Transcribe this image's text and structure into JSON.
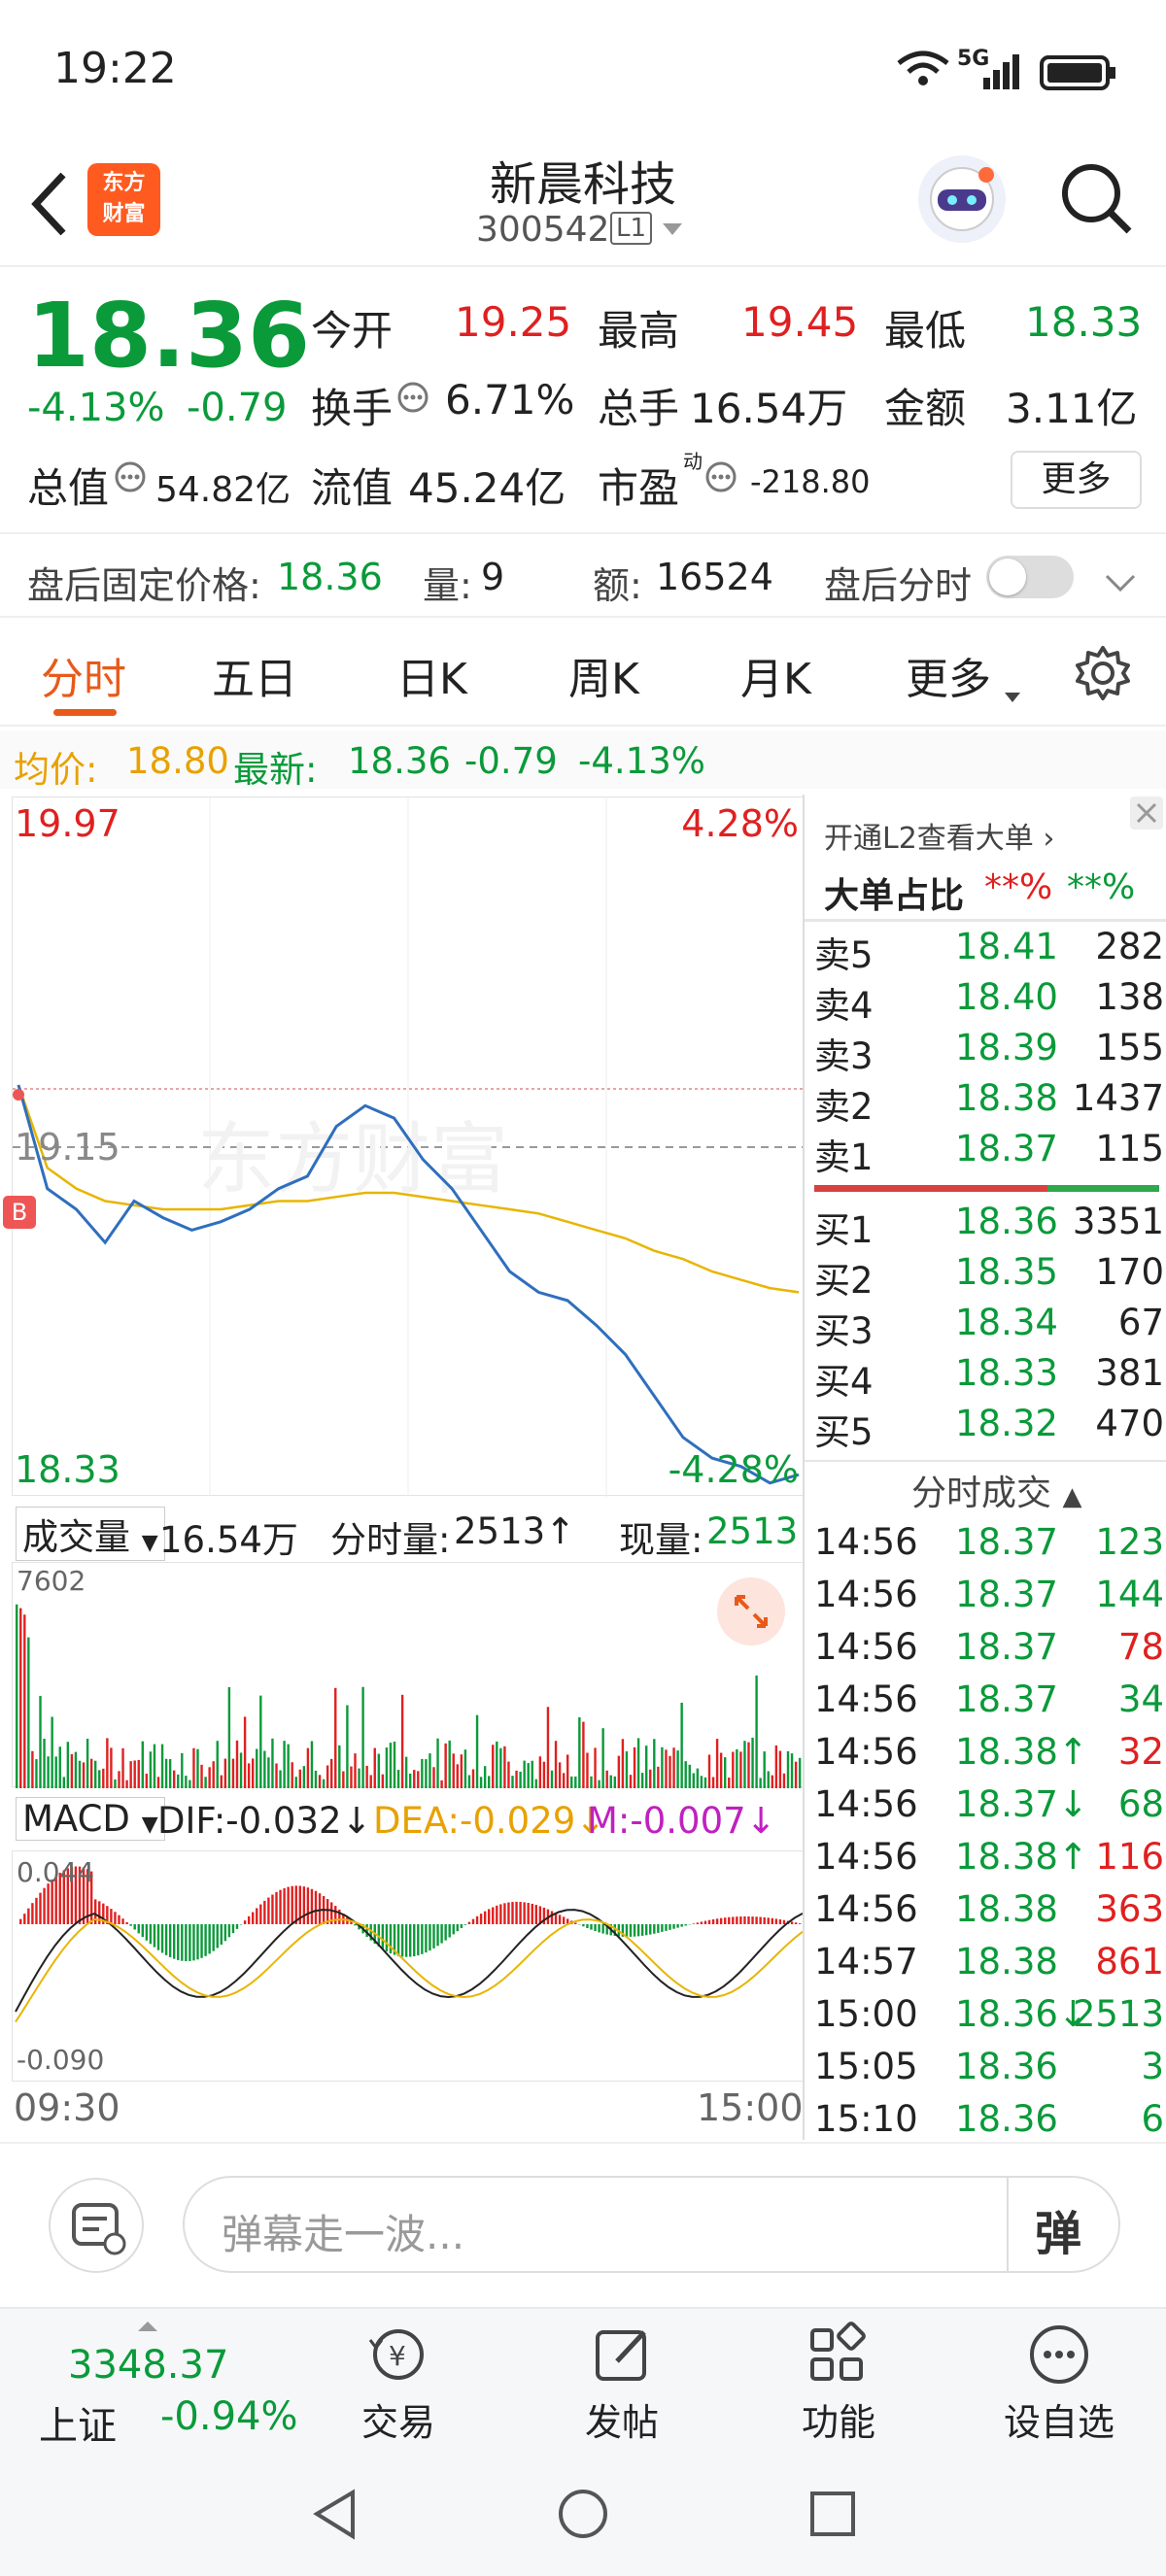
{
  "status_bar": {
    "time": "19:22",
    "network": "5G"
  },
  "header": {
    "title": "新晨科技",
    "code": "300542",
    "level_badge": "L1",
    "logo_line1": "东方",
    "logo_line2": "财富"
  },
  "quote": {
    "price": "18.36",
    "change_pct": "-4.13%",
    "change": "-0.79",
    "open_label": "今开",
    "open": "19.25",
    "high_label": "最高",
    "high": "19.45",
    "low_label": "最低",
    "low": "18.33",
    "turnover_label": "换手",
    "turnover": "6.71%",
    "volume_label": "总手",
    "volume": "16.54万",
    "amount_label": "金额",
    "amount": "3.11亿",
    "mktcap_label": "总值",
    "mktcap": "54.82亿",
    "float_label": "流值",
    "float_val": "45.24亿",
    "pe_label": "市盈",
    "pe_sup": "动",
    "pe": "-218.80",
    "more": "更多"
  },
  "after_hours": {
    "price_label": "盘后固定价格:",
    "price": "18.36",
    "qty_label": "量:",
    "qty": "9",
    "amt_label": "额:",
    "amt": "16524",
    "toggle_label": "盘后分时"
  },
  "tabs": [
    "分时",
    "五日",
    "日K",
    "周K",
    "月K",
    "更多"
  ],
  "avg_line": {
    "avg_label": "均价:",
    "avg": "18.80",
    "latest_label": "最新:",
    "latest": "18.36",
    "chg": "-0.79",
    "pct": "-4.13%"
  },
  "chart": {
    "y_top": "19.97",
    "y_mid": "19.15",
    "y_bottom": "18.33",
    "pct_top": "4.28%",
    "pct_bottom": "-4.28%",
    "watermark": "东方财富",
    "b_marker": "B",
    "x_start": "09:30",
    "x_end": "15:00",
    "vol_label": "成交量",
    "vol_total": "16.54万",
    "vol_min_label": "分时量:",
    "vol_min": "2513↑",
    "vol_now_label": "现量:",
    "vol_now": "2513",
    "vol_max": "7602",
    "macd_label": "MACD",
    "dif": "DIF:-0.032↓",
    "dea": "DEA:-0.029↓",
    "m": "M:-0.007↓",
    "macd_top": "0.044",
    "macd_bottom": "-0.090"
  },
  "chart_data": {
    "type": "line",
    "series": [
      {
        "name": "最新",
        "values": [
          19.3,
          19.05,
          19.0,
          18.92,
          19.02,
          18.98,
          18.95,
          18.97,
          19.0,
          19.05,
          19.08,
          19.2,
          19.25,
          19.22,
          19.12,
          19.05,
          18.95,
          18.85,
          18.8,
          18.78,
          18.72,
          18.65,
          18.55,
          18.45,
          18.4,
          18.38,
          18.34,
          18.36
        ]
      },
      {
        "name": "均价",
        "values": [
          19.3,
          19.1,
          19.05,
          19.02,
          19.01,
          19.0,
          19.0,
          19.0,
          19.01,
          19.02,
          19.02,
          19.03,
          19.04,
          19.04,
          19.03,
          19.02,
          19.01,
          19.0,
          18.99,
          18.97,
          18.95,
          18.93,
          18.9,
          18.88,
          18.85,
          18.83,
          18.81,
          18.8
        ]
      }
    ],
    "ylim": [
      18.33,
      19.97
    ]
  },
  "orderbook": {
    "l2_label": "开通L2查看大单",
    "ratio_label": "大单占比",
    "ratio_red": "**%",
    "ratio_green": "**%",
    "asks": [
      {
        "label": "卖5",
        "price": "18.41",
        "vol": "282"
      },
      {
        "label": "卖4",
        "price": "18.40",
        "vol": "138"
      },
      {
        "label": "卖3",
        "price": "18.39",
        "vol": "155"
      },
      {
        "label": "卖2",
        "price": "18.38",
        "vol": "1437"
      },
      {
        "label": "卖1",
        "price": "18.37",
        "vol": "115"
      }
    ],
    "bids": [
      {
        "label": "买1",
        "price": "18.36",
        "vol": "3351"
      },
      {
        "label": "买2",
        "price": "18.35",
        "vol": "170"
      },
      {
        "label": "买3",
        "price": "18.34",
        "vol": "67"
      },
      {
        "label": "买4",
        "price": "18.33",
        "vol": "381"
      },
      {
        "label": "买5",
        "price": "18.32",
        "vol": "470"
      }
    ],
    "trades_label": "分时成交",
    "trades": [
      {
        "t": "14:56",
        "p": "18.37",
        "v": "123",
        "c": "g"
      },
      {
        "t": "14:56",
        "p": "18.37",
        "v": "144",
        "c": "g"
      },
      {
        "t": "14:56",
        "p": "18.37",
        "v": "78",
        "c": "r"
      },
      {
        "t": "14:56",
        "p": "18.37",
        "v": "34",
        "c": "g"
      },
      {
        "t": "14:56",
        "p": "18.38↑",
        "v": "32",
        "c": "r"
      },
      {
        "t": "14:56",
        "p": "18.37↓",
        "v": "68",
        "c": "g"
      },
      {
        "t": "14:56",
        "p": "18.38↑",
        "v": "116",
        "c": "r"
      },
      {
        "t": "14:56",
        "p": "18.38",
        "v": "363",
        "c": "r"
      },
      {
        "t": "14:57",
        "p": "18.38",
        "v": "861",
        "c": "r"
      },
      {
        "t": "15:00",
        "p": "18.36↓",
        "v": "2513",
        "c": "g"
      },
      {
        "t": "15:05",
        "p": "18.36",
        "v": "3",
        "c": "g"
      },
      {
        "t": "15:10",
        "p": "18.36",
        "v": "6",
        "c": "g"
      }
    ]
  },
  "comment": {
    "placeholder": "弹幕走一波...",
    "danmu_btn": "弹"
  },
  "bottom": {
    "index_val": "3348.37",
    "index_name": "上证",
    "index_chg": "-0.94%",
    "trade": "交易",
    "post": "发帖",
    "func": "功能",
    "watch": "设自选"
  }
}
